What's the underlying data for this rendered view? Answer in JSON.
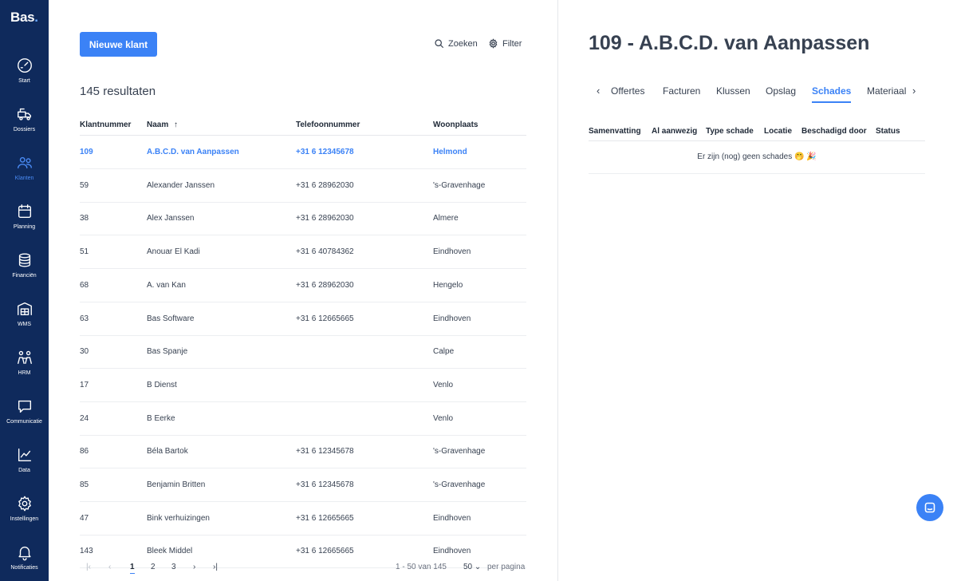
{
  "app": {
    "logo": "Bas",
    "logo_dot": "."
  },
  "sidebar": {
    "items": [
      {
        "label": "Start",
        "icon": "gauge-icon"
      },
      {
        "label": "Dossiers",
        "icon": "truck-icon"
      },
      {
        "label": "Klanten",
        "icon": "users-icon",
        "active": true
      },
      {
        "label": "Planning",
        "icon": "calendar-icon"
      },
      {
        "label": "Financiën",
        "icon": "coins-icon"
      },
      {
        "label": "WMS",
        "icon": "warehouse-icon"
      },
      {
        "label": "HRM",
        "icon": "people-icon"
      },
      {
        "label": "Communicatie",
        "icon": "chat-icon"
      },
      {
        "label": "Data",
        "icon": "chart-icon"
      },
      {
        "label": "Instellingen",
        "icon": "gear-icon"
      },
      {
        "label": "Notificaties",
        "icon": "bell-icon"
      }
    ]
  },
  "list": {
    "new_button": "Nieuwe klant",
    "search_label": "Zoeken",
    "filter_label": "Filter",
    "results": "145 resultaten",
    "columns": [
      "Klantnummer",
      "Naam",
      "Telefoonnummer",
      "Woonplaats"
    ],
    "sort_indicator": "↑",
    "rows": [
      {
        "nr": "109",
        "naam": "A.B.C.D. van Aanpassen",
        "tel": "+31 6 12345678",
        "plaats": "Helmond"
      },
      {
        "nr": "59",
        "naam": "Alexander Janssen",
        "tel": "+31 6 28962030",
        "plaats": "'s-Gravenhage"
      },
      {
        "nr": "38",
        "naam": "Alex Janssen",
        "tel": "+31 6 28962030",
        "plaats": "Almere"
      },
      {
        "nr": "51",
        "naam": "Anouar El Kadi",
        "tel": "+31 6 40784362",
        "plaats": "Eindhoven"
      },
      {
        "nr": "68",
        "naam": "A. van Kan",
        "tel": "+31 6 28962030",
        "plaats": "Hengelo"
      },
      {
        "nr": "63",
        "naam": "Bas Software",
        "tel": "+31 6 12665665",
        "plaats": "Eindhoven"
      },
      {
        "nr": "30",
        "naam": "Bas Spanje",
        "tel": "",
        "plaats": "Calpe"
      },
      {
        "nr": "17",
        "naam": "B Dienst",
        "tel": "",
        "plaats": "Venlo"
      },
      {
        "nr": "24",
        "naam": "B Eerke",
        "tel": "",
        "plaats": "Venlo"
      },
      {
        "nr": "86",
        "naam": "Béla Bartok",
        "tel": "+31 6 12345678",
        "plaats": "'s-Gravenhage"
      },
      {
        "nr": "85",
        "naam": "Benjamin Britten",
        "tel": "+31 6 12345678",
        "plaats": "'s-Gravenhage"
      },
      {
        "nr": "47",
        "naam": "Bink verhuizingen",
        "tel": "+31 6 12665665",
        "plaats": "Eindhoven"
      },
      {
        "nr": "143",
        "naam": "Bleek Middel",
        "tel": "+31 6 12665665",
        "plaats": "Eindhoven"
      }
    ],
    "pager": {
      "first": "|‹",
      "prev": "‹",
      "pages": [
        "1",
        "2",
        "3"
      ],
      "current": "1",
      "next": "›",
      "last": "›|",
      "range": "1 - 50 van 145",
      "per_page_value": "50",
      "per_page_label": "per pagina"
    }
  },
  "detail": {
    "title": "109 - A.B.C.D. van Aanpassen",
    "tabs": [
      "Offertes",
      "Facturen",
      "Klussen",
      "Opslag",
      "Schades",
      "Materiaal"
    ],
    "active_tab": "Schades",
    "columns": [
      "Samenvatting",
      "Al aanwezig",
      "Type schade",
      "Locatie",
      "Beschadigd door",
      "Status"
    ],
    "empty_message": "Er zijn (nog) geen schades 🤭 🎉"
  },
  "colors": {
    "sidebar": "#0f2a5c",
    "accent": "#3b82f6"
  }
}
